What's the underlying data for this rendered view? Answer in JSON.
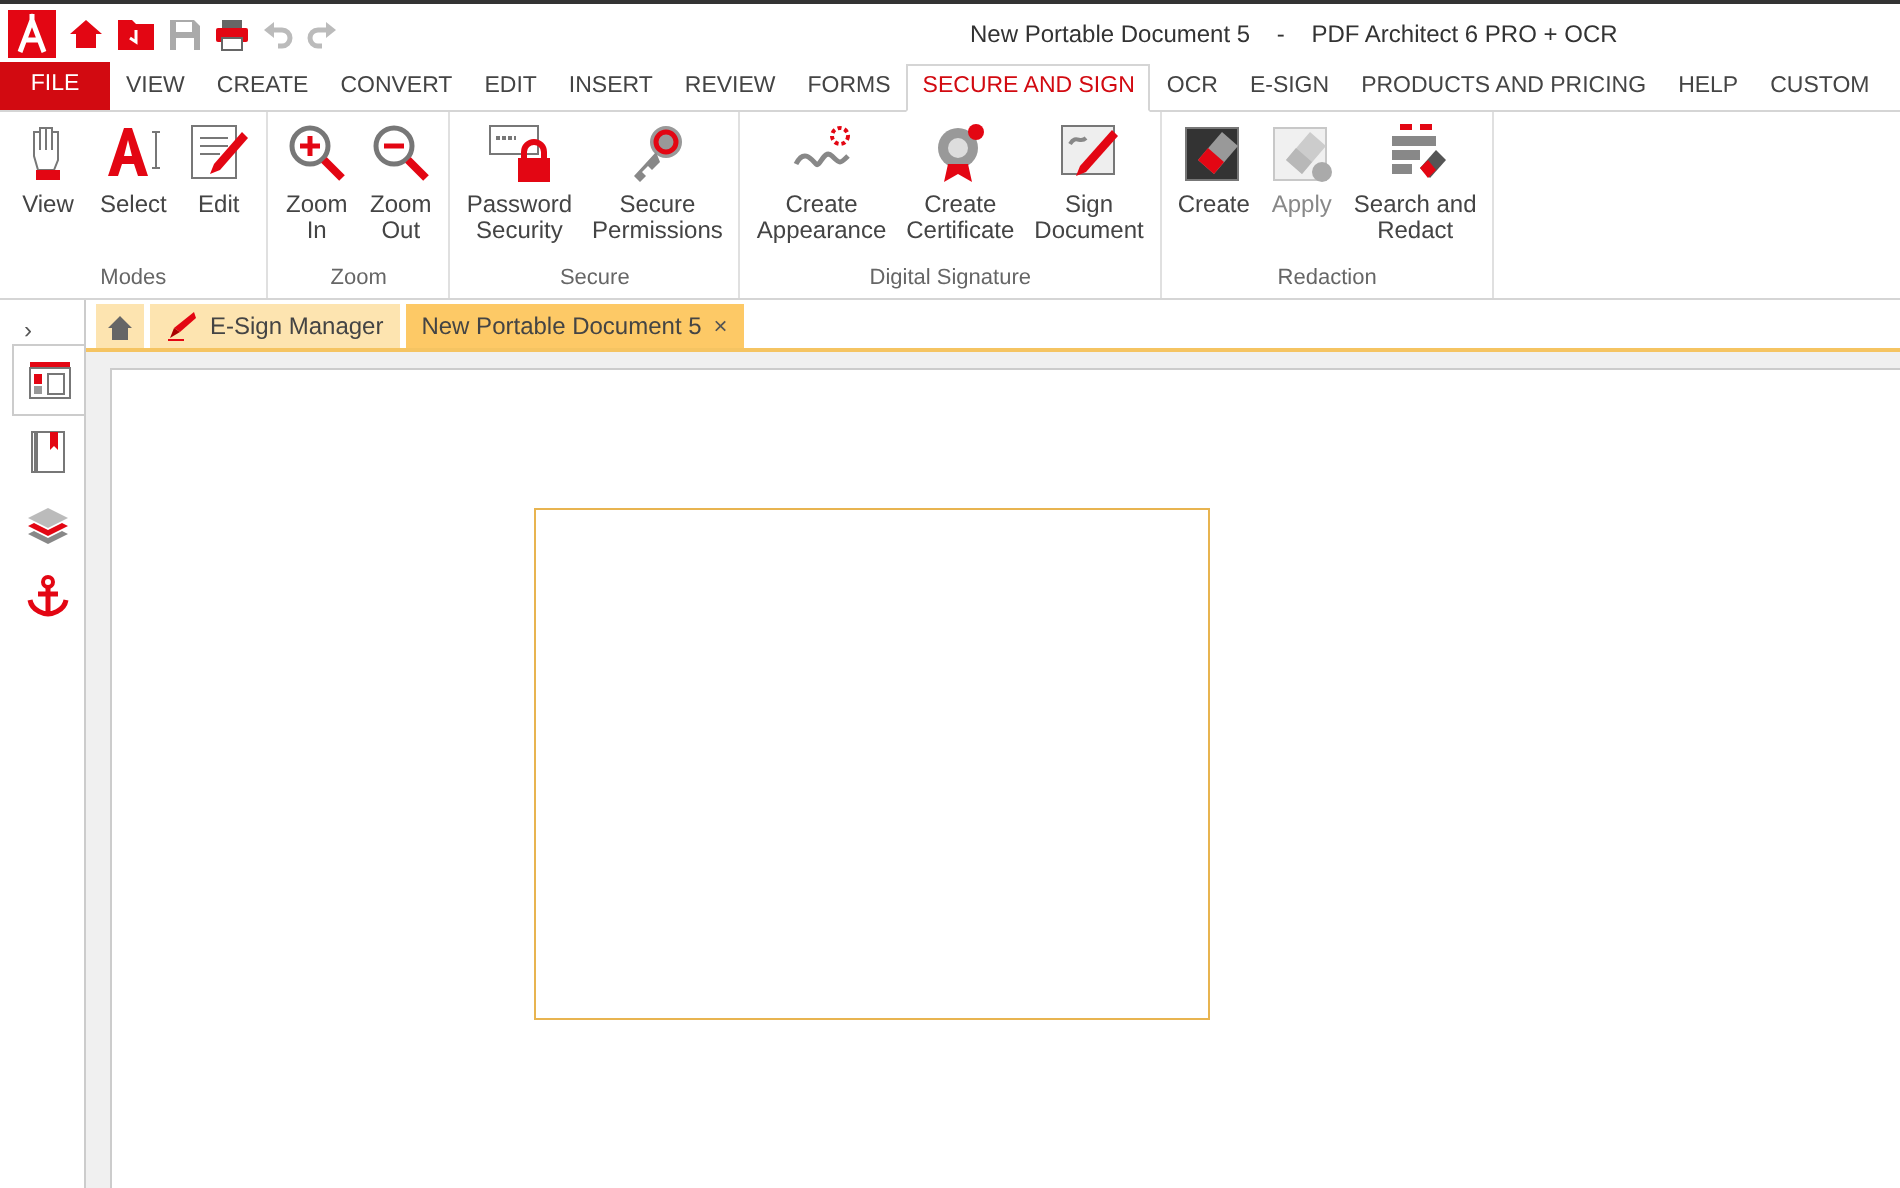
{
  "window": {
    "title": "New Portable Document 5    -    PDF Architect 6 PRO + OCR"
  },
  "menu": [
    {
      "label": "FILE",
      "kind": "file",
      "selected": false
    },
    {
      "label": "VIEW",
      "selected": false
    },
    {
      "label": "CREATE",
      "selected": false
    },
    {
      "label": "CONVERT",
      "selected": false
    },
    {
      "label": "EDIT",
      "selected": false
    },
    {
      "label": "INSERT",
      "selected": false
    },
    {
      "label": "REVIEW",
      "selected": false
    },
    {
      "label": "FORMS",
      "selected": false
    },
    {
      "label": "SECURE AND SIGN",
      "selected": true
    },
    {
      "label": "OCR",
      "selected": false
    },
    {
      "label": "E-SIGN",
      "selected": false
    },
    {
      "label": "PRODUCTS AND PRICING",
      "selected": false
    },
    {
      "label": "HELP",
      "selected": false
    },
    {
      "label": "CUSTOM",
      "selected": false
    }
  ],
  "ribbon": [
    {
      "label": "Modes",
      "buttons": [
        {
          "label": "View",
          "kind": "hand",
          "disabled": false
        },
        {
          "label": "Select",
          "kind": "select",
          "disabled": false
        },
        {
          "label": "Edit",
          "kind": "edit",
          "disabled": false
        }
      ]
    },
    {
      "label": "Zoom",
      "buttons": [
        {
          "label": "Zoom\nIn",
          "kind": "zoomin",
          "disabled": false
        },
        {
          "label": "Zoom\nOut",
          "kind": "zoomout",
          "disabled": false
        }
      ]
    },
    {
      "label": "Secure",
      "buttons": [
        {
          "label": "Password\nSecurity",
          "kind": "lock",
          "disabled": false
        },
        {
          "label": "Secure\nPermissions",
          "kind": "key",
          "disabled": false
        }
      ]
    },
    {
      "label": "Digital Signature",
      "buttons": [
        {
          "label": "Create\nAppearance",
          "kind": "sign",
          "disabled": false
        },
        {
          "label": "Create\nCertificate",
          "kind": "cert",
          "disabled": false
        },
        {
          "label": "Sign\nDocument",
          "kind": "signdoc",
          "disabled": false
        }
      ]
    },
    {
      "label": "Redaction",
      "buttons": [
        {
          "label": "Create",
          "kind": "eraser",
          "disabled": false
        },
        {
          "label": "Apply",
          "kind": "eraser",
          "disabled": true
        },
        {
          "label": "Search and\nRedact",
          "kind": "redact",
          "disabled": false
        }
      ]
    }
  ],
  "side_panel_toggle": "›",
  "side_panel": [
    {
      "kind": "pages",
      "selected": true
    },
    {
      "kind": "bookmarks",
      "selected": false
    },
    {
      "kind": "layers",
      "selected": false
    },
    {
      "kind": "anchor",
      "selected": false
    }
  ],
  "doc_tabs": [
    {
      "label": "E-Sign Manager",
      "selected": false
    },
    {
      "label": "New Portable Document 5",
      "selected": true,
      "close": "×"
    }
  ]
}
